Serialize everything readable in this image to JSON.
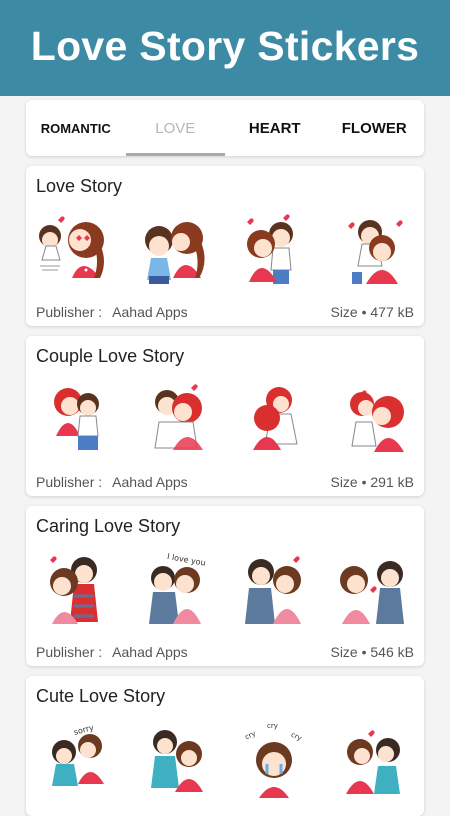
{
  "app": {
    "title": "Love Story Stickers"
  },
  "tabs": [
    {
      "label": "ROMANTIC",
      "active": false
    },
    {
      "label": "LOVE",
      "active": true
    },
    {
      "label": "HEART",
      "active": false
    },
    {
      "label": "FLOWER",
      "active": false
    }
  ],
  "colors": {
    "header": "#3d8aa4",
    "tab_indicator": "#aaaaaa"
  },
  "packs": [
    {
      "title": "Love Story",
      "publisher_label": "Publisher :",
      "publisher": "Aahad Apps",
      "size": "Size • 477 kB",
      "stickers": [
        "kiss-sticker",
        "cheek-kiss-sticker",
        "hug-sticker",
        "cuddle-sticker"
      ]
    },
    {
      "title": "Couple Love Story",
      "publisher_label": "Publisher :",
      "publisher": "Aahad Apps",
      "size": "Size • 291 kB",
      "stickers": [
        "sitting-couple-sticker",
        "hug-sticker",
        "embrace-sticker",
        "kiss-sticker"
      ]
    },
    {
      "title": "Caring Love Story",
      "publisher_label": "Publisher :",
      "publisher": "Aahad Apps",
      "size": "Size • 546 kB",
      "stickers": [
        "hug-sticker",
        "i-love-you-sticker",
        "forehead-sticker",
        "blow-kiss-sticker"
      ],
      "sticker_text": "I love you"
    },
    {
      "title": "Cute Love Story",
      "stickers": [
        "sorry-sticker",
        "comfort-sticker",
        "cry-sticker",
        "kiss-sticker"
      ],
      "sticker_text": [
        "sorry",
        "cry",
        "cry",
        "cry"
      ]
    }
  ]
}
